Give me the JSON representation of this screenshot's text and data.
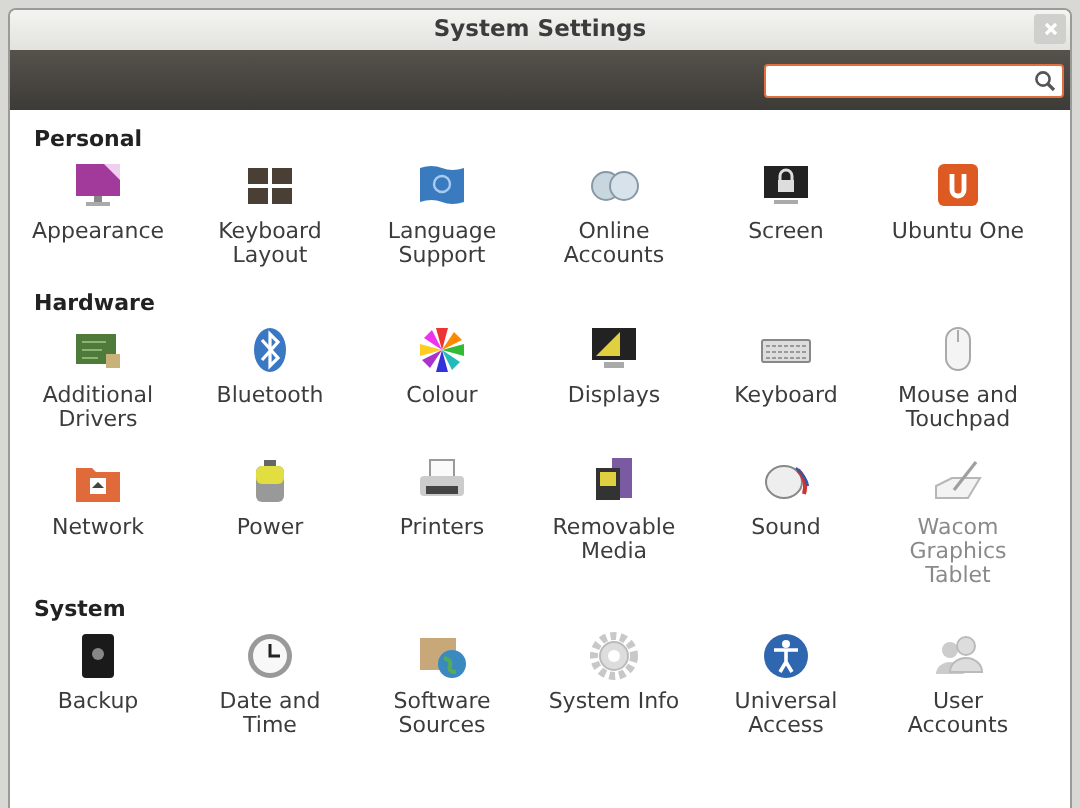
{
  "window": {
    "title": "System Settings"
  },
  "search": {
    "focused": true
  },
  "sections": [
    {
      "heading": "Personal",
      "items": [
        {
          "label": "Appearance",
          "disabled": false
        },
        {
          "label": "Keyboard Layout",
          "disabled": false
        },
        {
          "label": "Language Support",
          "disabled": false
        },
        {
          "label": "Online Accounts",
          "disabled": false
        },
        {
          "label": "Screen",
          "disabled": false
        },
        {
          "label": "Ubuntu One",
          "disabled": false
        }
      ]
    },
    {
      "heading": "Hardware",
      "items": [
        {
          "label": "Additional Drivers",
          "disabled": false
        },
        {
          "label": "Bluetooth",
          "disabled": false
        },
        {
          "label": "Colour",
          "disabled": false
        },
        {
          "label": "Displays",
          "disabled": false
        },
        {
          "label": "Keyboard",
          "disabled": false
        },
        {
          "label": "Mouse and Touchpad",
          "disabled": false
        },
        {
          "label": "Network",
          "disabled": false
        },
        {
          "label": "Power",
          "disabled": false
        },
        {
          "label": "Printers",
          "disabled": false
        },
        {
          "label": "Removable Media",
          "disabled": false
        },
        {
          "label": "Sound",
          "disabled": false
        },
        {
          "label": "Wacom Graphics Tablet",
          "disabled": true
        }
      ]
    },
    {
      "heading": "System",
      "items": [
        {
          "label": "Backup",
          "disabled": false
        },
        {
          "label": "Date and Time",
          "disabled": false
        },
        {
          "label": "Software Sources",
          "disabled": false
        },
        {
          "label": "System Info",
          "disabled": false
        },
        {
          "label": "Universal Access",
          "disabled": false
        },
        {
          "label": "User Accounts",
          "disabled": false
        }
      ]
    }
  ]
}
